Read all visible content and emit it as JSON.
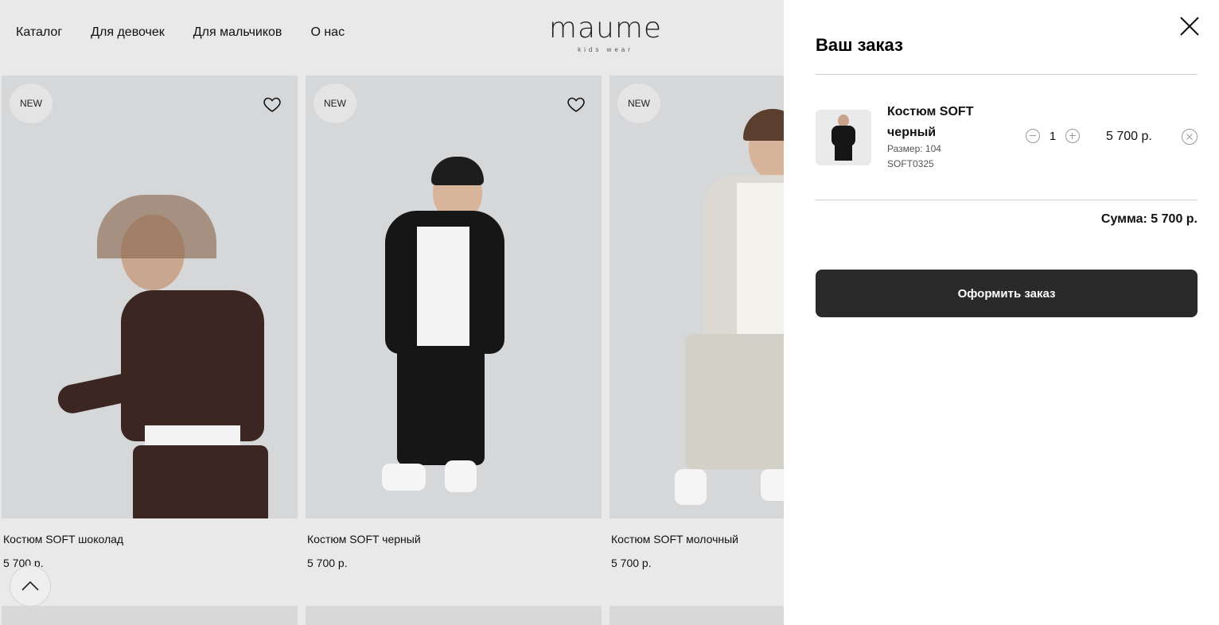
{
  "nav": {
    "items": [
      "Каталог",
      "Для девочек",
      "Для мальчиков",
      "О нас"
    ]
  },
  "logo": {
    "word": "maume",
    "tagline": "kids wear"
  },
  "products": [
    {
      "badge": "NEW",
      "name": "Костюм SOFT шоколад",
      "price": "5 700 р."
    },
    {
      "badge": "NEW",
      "name": "Костюм SOFT черный",
      "price": "5 700 р."
    },
    {
      "badge": "NEW",
      "name": "Костюм SOFT молочный",
      "price": "5 700 р."
    }
  ],
  "cart": {
    "title": "Ваш заказ",
    "item": {
      "name": "Костюм SOFT черный",
      "size": "Размер: 104",
      "sku": "SOFT0325",
      "quantity": "1",
      "price": "5 700 р."
    },
    "total": "Сумма: 5 700 р.",
    "checkout_label": "Оформить заказ"
  },
  "icons": {
    "favorite": "heart-icon",
    "close": "close-icon",
    "minus": "minus-circle-icon",
    "plus": "plus-circle-icon",
    "remove": "remove-circle-icon",
    "scroll_top": "chevron-up-icon"
  },
  "colors": {
    "page_bg": "#e9e9e9",
    "panel_bg": "#ffffff",
    "button_bg": "#2a2a2a",
    "chocolate": "#3b2621",
    "black_suit": "#161616",
    "milk_suit": "#dcdad3"
  }
}
